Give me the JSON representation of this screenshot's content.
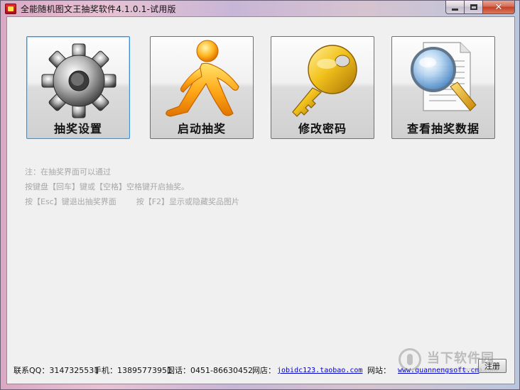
{
  "window": {
    "title": "全能随机图文王抽奖软件4.1.0.1-试用版"
  },
  "tiles": [
    {
      "label": "抽奖设置",
      "icon": "gear-icon"
    },
    {
      "label": "启动抽奖",
      "icon": "running-man-icon"
    },
    {
      "label": "修改密码",
      "icon": "key-icon"
    },
    {
      "label": "查看抽奖数据",
      "icon": "magnifier-document-icon"
    }
  ],
  "notes": {
    "line1": "注：在抽奖界面可以通过",
    "line2": "按键盘【回车】键或【空格】空格键开启抽奖。",
    "line3": "按【Esc】键退出抽奖界面        按【F2】显示或隐藏奖品图片"
  },
  "footer": {
    "qq": "联系QQ：3147325531",
    "mobile": "手机：13895773951",
    "phone": "固话：0451-86630452",
    "shop_label": "网店：",
    "shop_url": "jobidc123.taobao.com",
    "site_label": "网站：",
    "site_url": "www.quannengsoft.cn",
    "register_label": "注册"
  },
  "watermark": {
    "text": "当下软件园",
    "url": "www.downxia.com"
  },
  "colors": {
    "active_tile_border": "#3c8fd6",
    "link": "#0000cc",
    "note_text": "#a8a8a8"
  }
}
